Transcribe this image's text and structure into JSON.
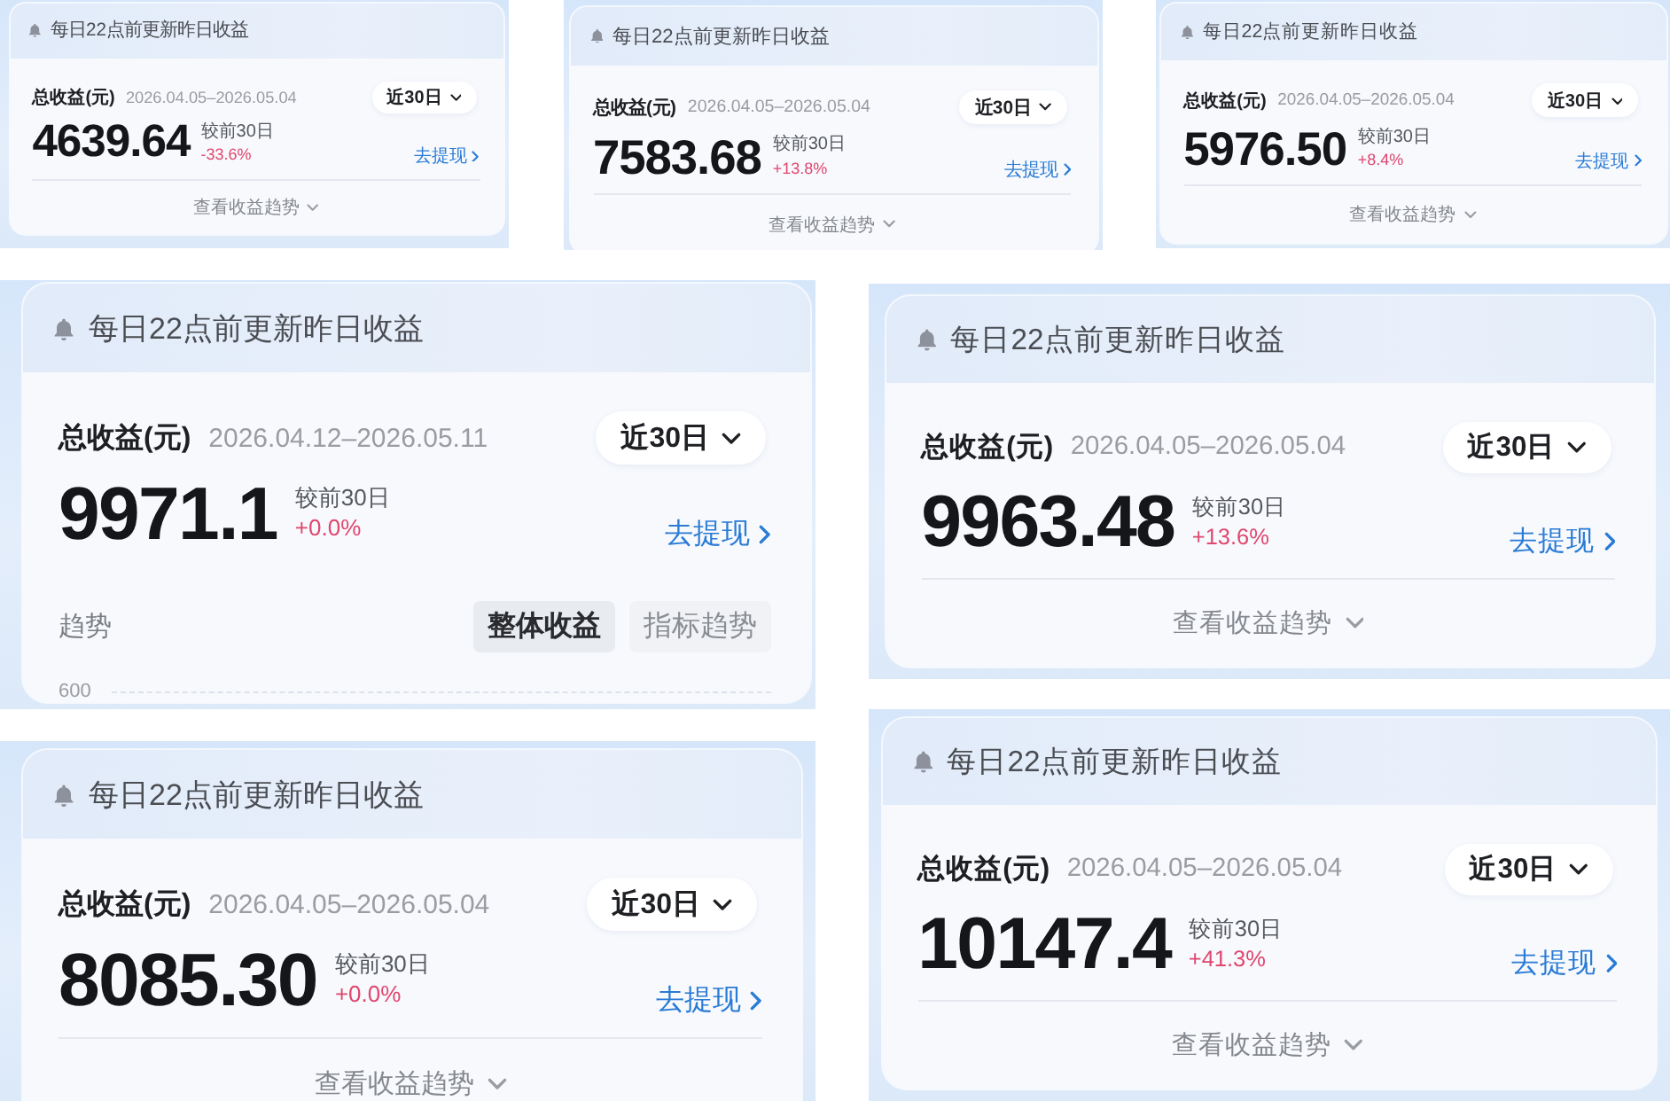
{
  "panels": [
    {
      "kind": "collapsed",
      "notice": "每日22点前更新昨日收益",
      "total_label": "总收益(元)",
      "date_range": "2026.04.05–2026.05.04",
      "period": "近30日",
      "amount": "4639.64",
      "compare_label": "较前30日",
      "change": "-33.6%",
      "withdraw": "去提现",
      "trend_toggle": "查看收益趋势"
    },
    {
      "kind": "collapsed",
      "notice": "每日22点前更新昨日收益",
      "total_label": "总收益(元)",
      "date_range": "2026.04.05–2026.05.04",
      "period": "近30日",
      "amount": "7583.68",
      "compare_label": "较前30日",
      "change": "+13.8%",
      "withdraw": "去提现",
      "trend_toggle": "查看收益趋势"
    },
    {
      "kind": "collapsed",
      "notice": "每日22点前更新昨日收益",
      "total_label": "总收益(元)",
      "date_range": "2026.04.05–2026.05.04",
      "period": "近30日",
      "amount": "5976.50",
      "compare_label": "较前30日",
      "change": "+8.4%",
      "withdraw": "去提现",
      "trend_toggle": "查看收益趋势"
    },
    {
      "kind": "expanded",
      "notice": "每日22点前更新昨日收益",
      "total_label": "总收益(元)",
      "date_range": "2026.04.12–2026.05.11",
      "period": "近30日",
      "amount": "9971.1",
      "compare_label": "较前30日",
      "change": "+0.0%",
      "withdraw": "去提现",
      "trend_title": "趋势",
      "trend_tabs": [
        {
          "label": "整体收益",
          "selected": true
        },
        {
          "label": "指标趋势",
          "selected": false
        }
      ],
      "axis_label": "600"
    },
    {
      "kind": "collapsed",
      "notice": "每日22点前更新昨日收益",
      "total_label": "总收益(元)",
      "date_range": "2026.04.05–2026.05.04",
      "period": "近30日",
      "amount": "9963.48",
      "compare_label": "较前30日",
      "change": "+13.6%",
      "withdraw": "去提现",
      "trend_toggle": "查看收益趋势"
    },
    {
      "kind": "collapsed",
      "notice": "每日22点前更新昨日收益",
      "total_label": "总收益(元)",
      "date_range": "2026.04.05–2026.05.04",
      "period": "近30日",
      "amount": "8085.30",
      "compare_label": "较前30日",
      "change": "+0.0%",
      "withdraw": "去提现",
      "trend_toggle": "查看收益趋势"
    },
    {
      "kind": "collapsed",
      "notice": "每日22点前更新昨日收益",
      "total_label": "总收益(元)",
      "date_range": "2026.04.05–2026.05.04",
      "period": "近30日",
      "amount": "10147.4",
      "compare_label": "较前30日",
      "change": "+41.3%",
      "withdraw": "去提现",
      "trend_toggle": "查看收益趋势"
    }
  ]
}
